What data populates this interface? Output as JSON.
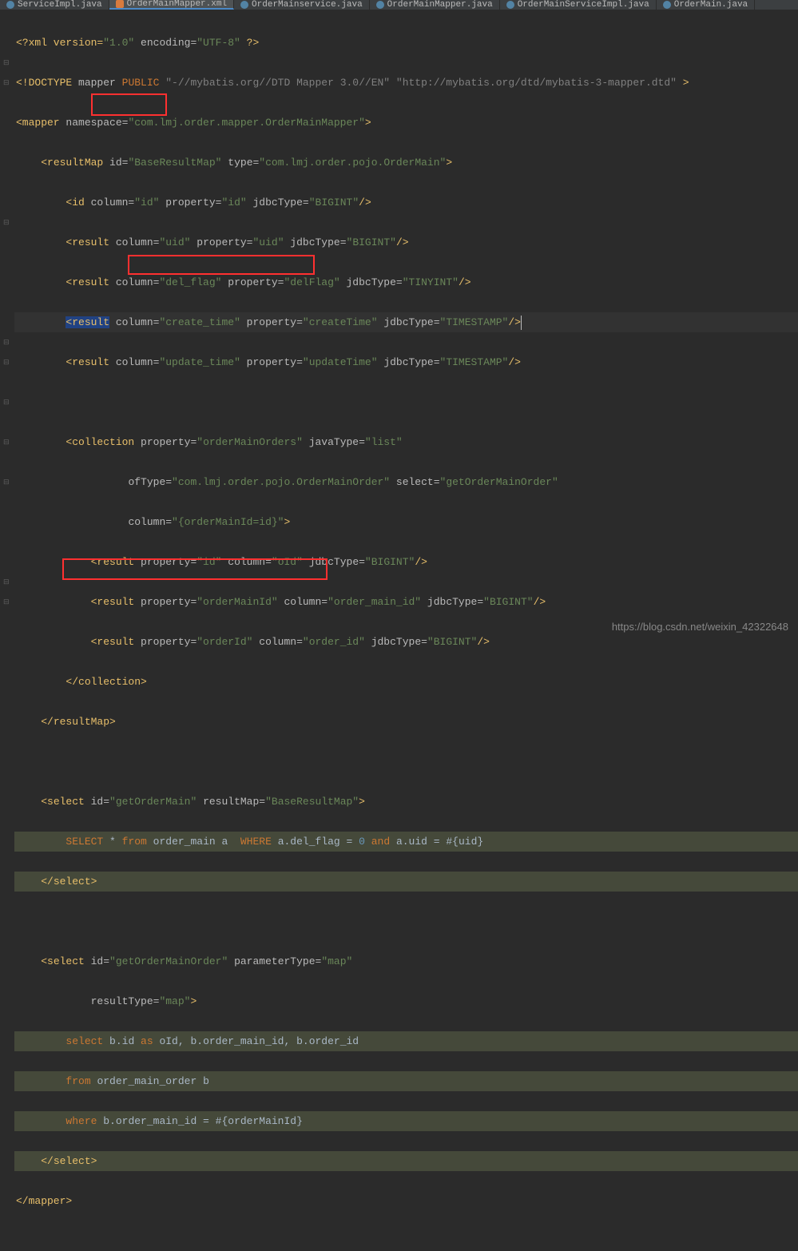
{
  "tabs": [
    {
      "label": "ServiceImpl.java",
      "icon": "java",
      "active": false
    },
    {
      "label": "OrderMainMapper.xml",
      "icon": "xml",
      "active": true
    },
    {
      "label": "OrderMainservice.java",
      "icon": "java",
      "active": false
    },
    {
      "label": "OrderMainMapper.java",
      "icon": "java",
      "active": false
    },
    {
      "label": "OrderMainServiceImpl.java",
      "icon": "java",
      "active": false
    },
    {
      "label": "OrderMain.java",
      "icon": "java",
      "active": false
    }
  ],
  "code": {
    "l1": {
      "xml_decl": "<?xml version=",
      "v1": "\"1.0\"",
      "enc": " encoding=",
      "v2": "\"UTF-8\"",
      "end": " ?>"
    },
    "l2": {
      "doctype": "<!DOCTYPE",
      "mapper": " mapper ",
      "public": "PUBLIC",
      "v1": " \"-//mybatis.org//DTD Mapper 3.0//EN\" \"http://mybatis.org/dtd/mybatis-3-mapper.dtd\" ",
      "end": ">"
    },
    "l3": {
      "tag": "<mapper",
      "attr": " namespace=",
      "val": "\"com.lmj.order.mapper.OrderMainMapper\"",
      "end": ">"
    },
    "l4": {
      "indent": "    ",
      "tag": "<resultMap",
      "attr1": " id=",
      "val1": "\"BaseResultMap\"",
      "attr2": " type=",
      "val2": "\"com.lmj.order.pojo.OrderMain\"",
      "end": ">"
    },
    "l5": {
      "indent": "        ",
      "tag": "<id",
      "attr1": " column=",
      "val1": "\"id\"",
      "attr2": " property=",
      "val2": "\"id\"",
      "attr3": " jdbcType=",
      "val3": "\"BIGINT\"",
      "end": "/>"
    },
    "l6": {
      "indent": "        ",
      "tag": "<result",
      "attr1": " column=",
      "val1": "\"uid\"",
      "attr2": " property=",
      "val2": "\"uid\"",
      "attr3": " jdbcType=",
      "val3": "\"BIGINT\"",
      "end": "/>"
    },
    "l7": {
      "indent": "        ",
      "tag": "<result",
      "attr1": " column=",
      "val1": "\"del_flag\"",
      "attr2": " property=",
      "val2": "\"delFlag\"",
      "attr3": " jdbcType=",
      "val3": "\"TINYINT\"",
      "end": "/>"
    },
    "l8": {
      "indent": "        ",
      "tag": "<result",
      "attr1": " column=",
      "val1": "\"create_time\"",
      "attr2": " property=",
      "val2": "\"createTime\"",
      "attr3": " jdbcType=",
      "val3": "\"TIMESTAMP\"",
      "end": "/>"
    },
    "l9": {
      "indent": "        ",
      "tag": "<result",
      "attr1": " column=",
      "val1": "\"update_time\"",
      "attr2": " property=",
      "val2": "\"updateTime\"",
      "attr3": " jdbcType=",
      "val3": "\"TIMESTAMP\"",
      "end": "/>"
    },
    "l11": {
      "indent": "        ",
      "tag": "<collection",
      "attr1": " property=",
      "val1": "\"orderMainOrders\"",
      "attr2": " javaType=",
      "val2": "\"list\""
    },
    "l12": {
      "indent": "                  ",
      "attr1": "ofType=",
      "val1": "\"com.lmj.order.pojo.OrderMainOrder\"",
      "attr2": " select=",
      "val2": "\"getOrderMainOrder\""
    },
    "l13": {
      "indent": "                  ",
      "attr1": "column=",
      "val1": "\"{orderMainId=id}\"",
      "end": ">"
    },
    "l14": {
      "indent": "            ",
      "tag": "<result",
      "attr1": " property=",
      "val1": "\"id\"",
      "attr2": " column=",
      "val2": "\"oId\"",
      "attr3": " jdbcType=",
      "val3": "\"BIGINT\"",
      "end": "/>"
    },
    "l15": {
      "indent": "            ",
      "tag": "<result",
      "attr1": " property=",
      "val1": "\"orderMainId\"",
      "attr2": " column=",
      "val2": "\"order_main_id\"",
      "attr3": " jdbcType=",
      "val3": "\"BIGINT\"",
      "end": "/>"
    },
    "l16": {
      "indent": "            ",
      "tag": "<result",
      "attr1": " property=",
      "val1": "\"orderId\"",
      "attr2": " column=",
      "val2": "\"order_id\"",
      "attr3": " jdbcType=",
      "val3": "\"BIGINT\"",
      "end": "/>"
    },
    "l17": {
      "indent": "        ",
      "tag": "</collection>"
    },
    "l18": {
      "indent": "    ",
      "tag": "</resultMap>"
    },
    "l20": {
      "indent": "    ",
      "tag": "<select",
      "attr1": " id=",
      "val1": "\"getOrderMain\"",
      "attr2": " resultMap=",
      "val2": "\"BaseResultMap\"",
      "end": ">"
    },
    "l21": {
      "indent": "        ",
      "kw1": "SELECT",
      "star": " * ",
      "kw2": "from",
      "tbl": " order_main a  ",
      "kw3": "WHERE",
      "cond1": " a.del_flag = ",
      "num": "0",
      "kw4": " and",
      "cond2": " a.uid = #{uid}"
    },
    "l22": {
      "indent": "    ",
      "tag": "</select>"
    },
    "l24": {
      "indent": "    ",
      "tag": "<select",
      "attr1": " id=",
      "val1": "\"getOrderMainOrder\"",
      "attr2": " parameterType=",
      "val2": "\"map\""
    },
    "l25": {
      "indent": "            ",
      "attr1": "resultType=",
      "val1": "\"map\"",
      "end": ">"
    },
    "l26": {
      "indent": "        ",
      "kw1": "select",
      "id": " b.id ",
      "kw2": "as",
      "rest": " oId, b.order_main_id, b.order_id"
    },
    "l27": {
      "indent": "        ",
      "kw1": "from",
      "rest": " order_main_order b"
    },
    "l28": {
      "indent": "        ",
      "kw1": "where",
      "rest": " b.order_main_id = #{orderMainId}"
    },
    "l29": {
      "indent": "    ",
      "tag": "</select>"
    },
    "l30": {
      "tag": "</mapper>"
    }
  },
  "watermark": "https://blog.csdn.net/weixin_42322648"
}
